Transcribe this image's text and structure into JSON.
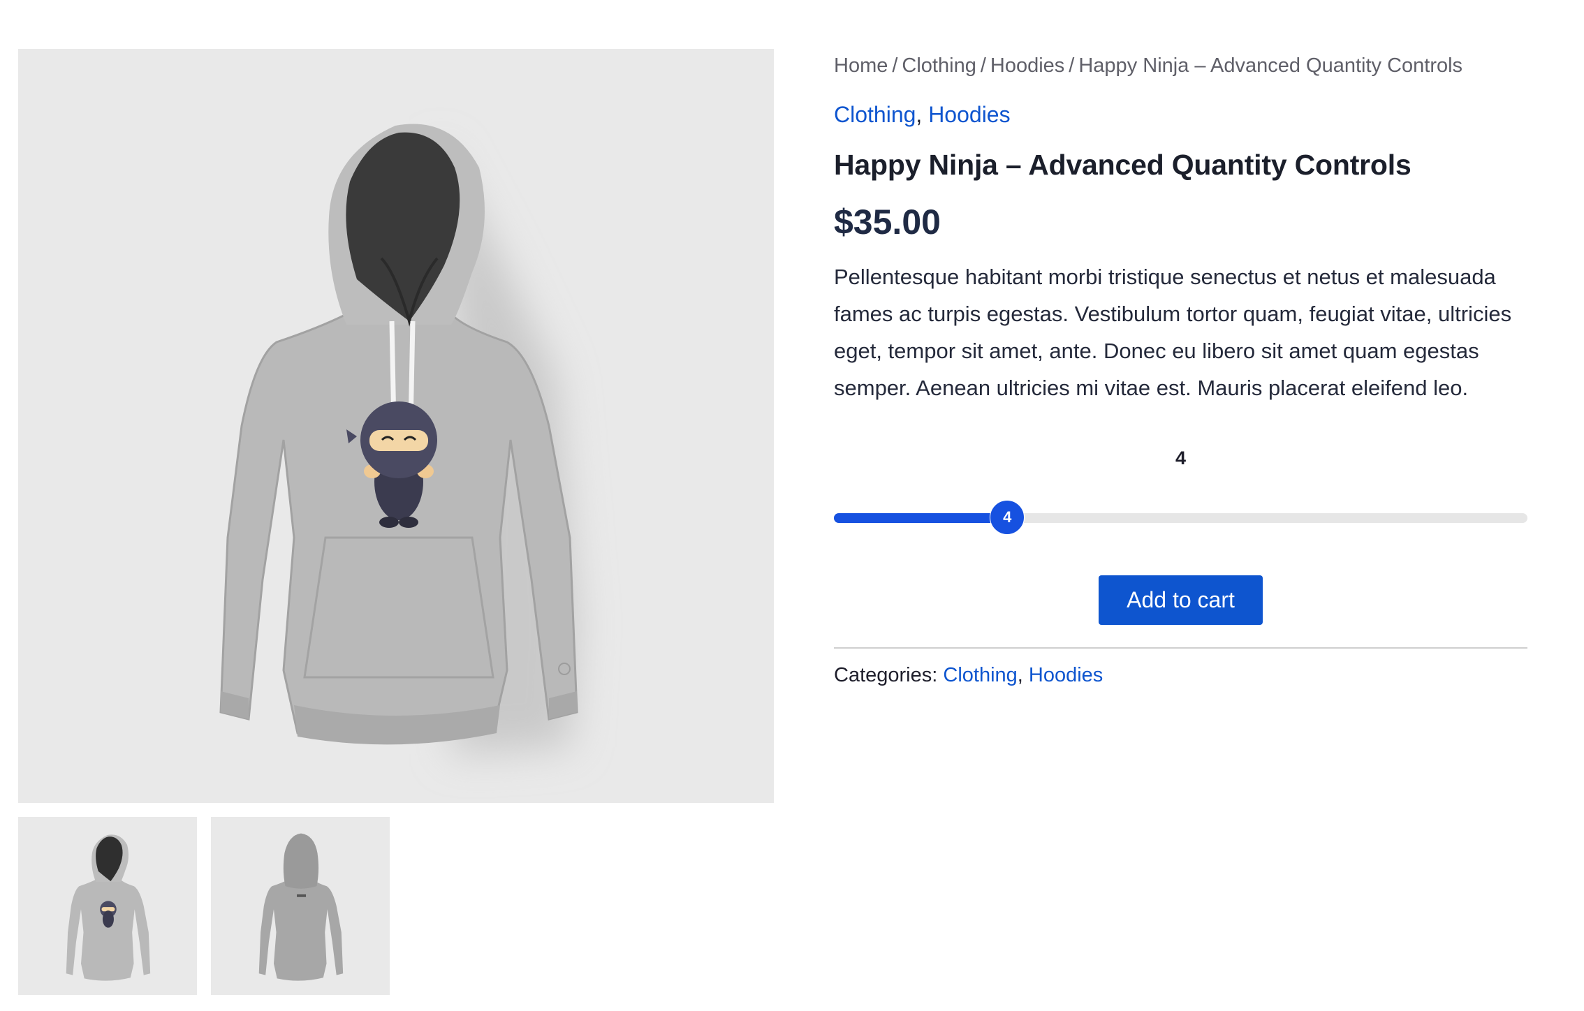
{
  "breadcrumb": {
    "home": "Home",
    "clothing": "Clothing",
    "hoodies": "Hoodies",
    "current": "Happy Ninja – Advanced Quantity Controls",
    "separator": "/"
  },
  "product": {
    "categories_top": [
      "Clothing",
      "Hoodies"
    ],
    "title": "Happy Ninja – Advanced Quantity Controls",
    "price": "$35.00",
    "description": "Pellentesque habitant morbi tristique senectus et netus et malesuada fames ac turpis egestas. Vestibulum tortor quam, feugiat vitae, ultricies eget, tempor sit amet, ante. Donec eu libero sit amet quam egestas semper. Aenean ultricies mi vitae est. Mauris placerat eleifend leo."
  },
  "quantity": {
    "value": "4",
    "thumb_label": "4",
    "fill_fraction": 0.25
  },
  "cart": {
    "button_label": "Add to cart"
  },
  "meta": {
    "categories_label": "Categories:",
    "categories": [
      "Clothing",
      "Hoodies"
    ]
  },
  "colors": {
    "accent": "#1651e0",
    "link": "#0e55cf",
    "image_bg": "#e9e9e9"
  }
}
